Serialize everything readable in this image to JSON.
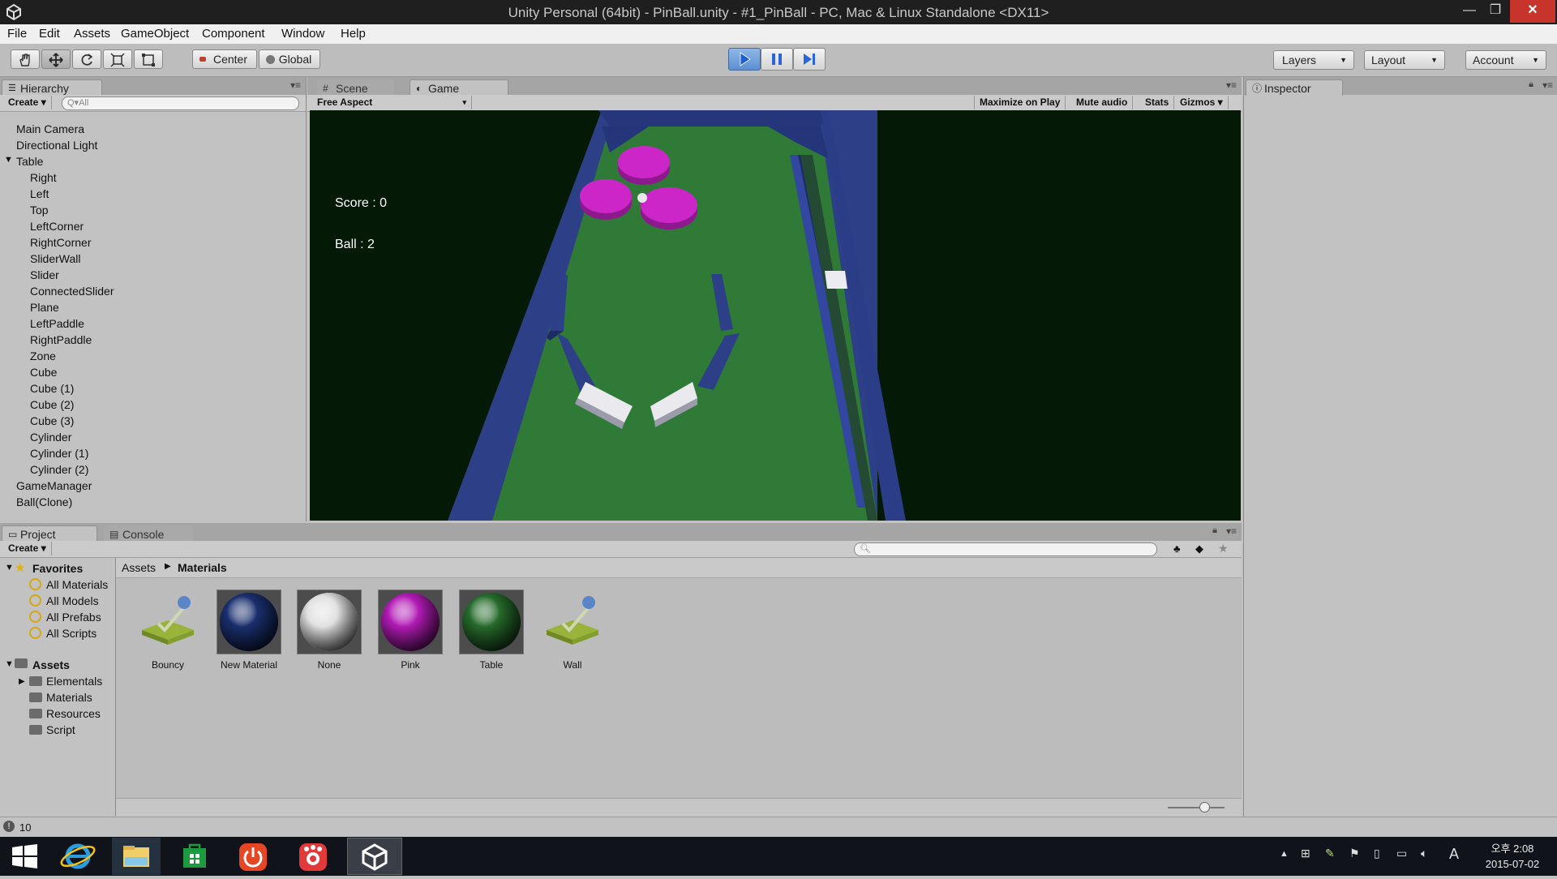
{
  "window": {
    "title": "Unity Personal (64bit) - PinBall.unity - #1_PinBall - PC, Mac & Linux Standalone <DX11>",
    "controls": {
      "minimize": "—",
      "restore": "❐",
      "close": "✕"
    }
  },
  "menu": [
    "File",
    "Edit",
    "Assets",
    "GameObject",
    "Component",
    "Window",
    "Help"
  ],
  "toolbar": {
    "tools": [
      "hand-icon",
      "move-icon",
      "rotate-icon",
      "scale-icon",
      "rect-icon"
    ],
    "pivot_label": "Center",
    "space_label": "Global",
    "play_state": "playing",
    "layers_label": "Layers",
    "layout_label": "Layout",
    "account_label": "Account"
  },
  "hierarchy": {
    "tab_label": "Hierarchy",
    "create_label": "Create",
    "search_placeholder": "Q▾All",
    "items": [
      "Main Camera",
      "Directional Light",
      "Table",
      "Right",
      "Left",
      "Top",
      "LeftCorner",
      "RightCorner",
      "SliderWall",
      "Slider",
      "ConnectedSlider",
      "Plane",
      "LeftPaddle",
      "RightPaddle",
      "Zone",
      "Cube",
      "Cube (1)",
      "Cube (2)",
      "Cube (3)",
      "Cylinder",
      "Cylinder (1)",
      "Cylinder (2)",
      "GameManager",
      "Ball(Clone)"
    ]
  },
  "scene_tab": "Scene",
  "game_tab": "Game",
  "game_bar": {
    "aspect": "Free Aspect",
    "maximize": "Maximize on Play",
    "mute": "Mute audio",
    "stats": "Stats",
    "gizmos": "Gizmos"
  },
  "game": {
    "score_text": "Score : 0",
    "ball_text": "Ball : 2"
  },
  "colors": {
    "table": "#2f7a37",
    "wall": "#2d3f87",
    "bumper": "#cc26c8",
    "bg": "#041a07",
    "play_blue": "#5b8fd2"
  },
  "inspector_tab": "Inspector",
  "project": {
    "tab_label": "Project",
    "console_label": "Console",
    "create_label": "Create",
    "favorites_label": "Favorites",
    "favorites": [
      "All Materials",
      "All Models",
      "All Prefabs",
      "All Scripts"
    ],
    "assets_label": "Assets",
    "folders": [
      "Elementals",
      "Materials",
      "Resources",
      "Script"
    ],
    "breadcrumb": [
      "Assets",
      "Materials"
    ],
    "materials": [
      {
        "name": "Bouncy",
        "kind": "physic"
      },
      {
        "name": "New Material",
        "kind": "sphere",
        "color": "#1a2f6e"
      },
      {
        "name": "None",
        "kind": "sphere",
        "color": "#e0e0e0"
      },
      {
        "name": "Pink",
        "kind": "sphere",
        "color": "#b21bb5"
      },
      {
        "name": "Table",
        "kind": "sphere",
        "color": "#266b2c"
      },
      {
        "name": "Wall",
        "kind": "physic"
      }
    ]
  },
  "status": {
    "count": "10"
  },
  "clock": {
    "time": "오후 2:08",
    "date": "2015-07-02"
  },
  "tray_lang": "A"
}
